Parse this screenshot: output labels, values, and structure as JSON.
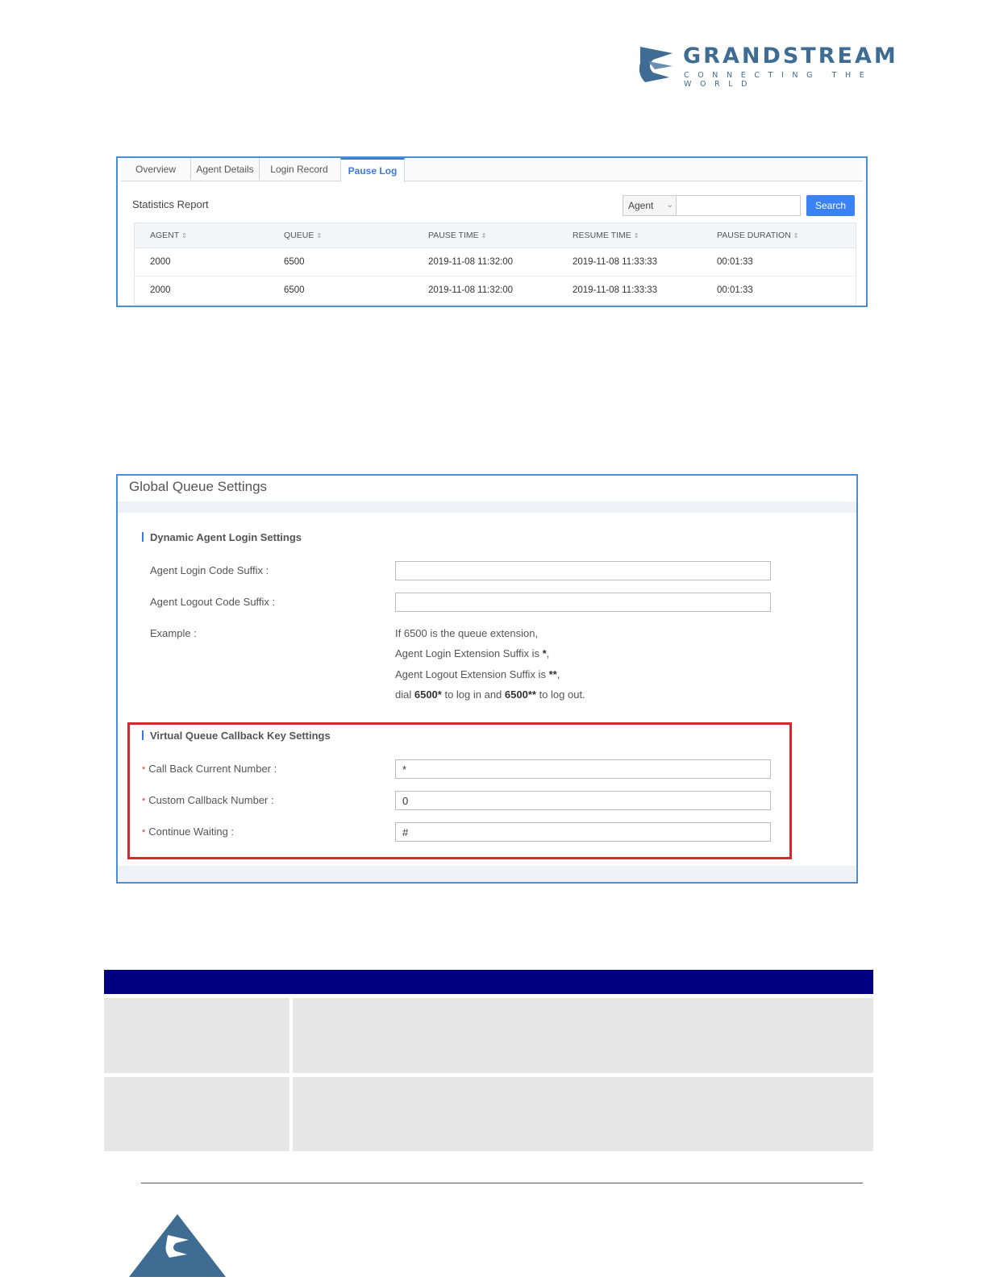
{
  "header": {
    "brand": "GRANDSTREAM",
    "tagline": "CONNECTING THE WORLD"
  },
  "pause_log": {
    "tabs": [
      {
        "label": "Overview"
      },
      {
        "label": "Agent Details"
      },
      {
        "label": "Login Record"
      },
      {
        "label": "Pause Log",
        "active": true
      }
    ],
    "section_title": "Statistics Report",
    "filter_select": "Agent",
    "search_value": "",
    "search_label": "Search",
    "columns": [
      "AGENT",
      "QUEUE",
      "PAUSE TIME",
      "RESUME TIME",
      "PAUSE DURATION"
    ],
    "rows": [
      [
        "2000",
        "6500",
        "2019-11-08 11:32:00",
        "2019-11-08 11:33:33",
        "00:01:33"
      ],
      [
        "2000",
        "6500",
        "2019-11-08 11:32:00",
        "2019-11-08 11:33:33",
        "00:01:33"
      ]
    ]
  },
  "global_queue": {
    "title": "Global Queue Settings",
    "dynamic_section": {
      "heading": "Dynamic Agent Login Settings",
      "login_label": "Agent Login Code Suffix :",
      "login_value": "",
      "logout_label": "Agent Logout Code Suffix :",
      "logout_value": "",
      "example_label": "Example :",
      "example_line1": "If 6500 is the queue extension,",
      "example_line2_prefix": "Agent Login Extension Suffix is ",
      "example_line2_bold": "*",
      "example_line2_suffix": ",",
      "example_line3_prefix": "Agent Logout Extension Suffix is ",
      "example_line3_bold": "**",
      "example_line3_suffix": ",",
      "example_line4_a": "dial ",
      "example_line4_b": "6500*",
      "example_line4_c": " to log in and ",
      "example_line4_d": "6500**",
      "example_line4_e": " to log out."
    },
    "callback_section": {
      "heading": "Virtual Queue Callback Key Settings",
      "required_mark": "*",
      "fields": [
        {
          "label": "Call Back Current Number :",
          "value": "*"
        },
        {
          "label": "Custom Callback Number :",
          "value": "0"
        },
        {
          "label": "Continue Waiting :",
          "value": "#"
        }
      ]
    }
  },
  "colors": {
    "accent_blue": "#3b82f6",
    "highlight_red": "#d5282f",
    "table_header_navy": "#000080",
    "brand_blue": "#3e6c93"
  }
}
